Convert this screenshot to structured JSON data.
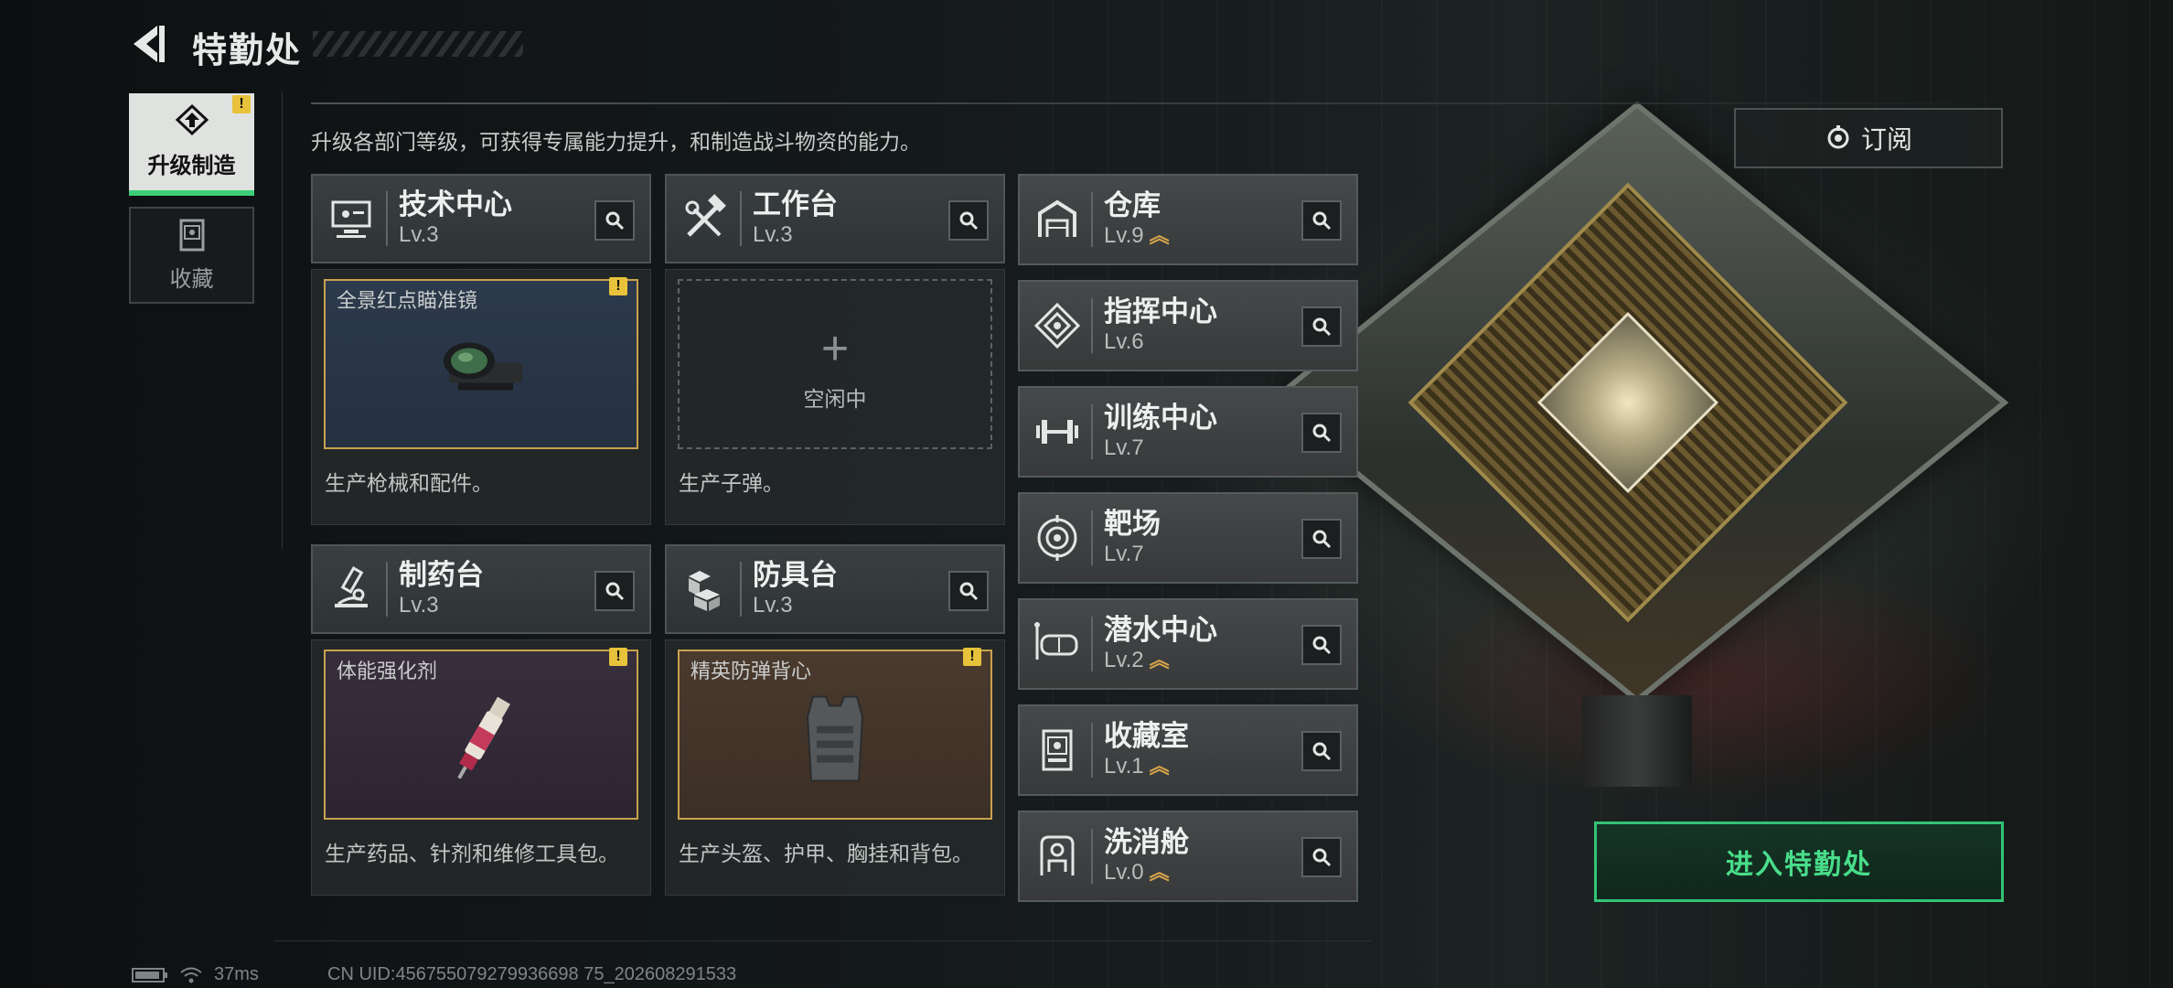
{
  "header": {
    "title": "特勤处"
  },
  "sidebar": {
    "tabs": [
      {
        "label": "升级制造",
        "active": true,
        "warning": "!"
      },
      {
        "label": "收藏",
        "active": false
      }
    ]
  },
  "description": "升级各部门等级，可获得专属能力提升，和制造战斗物资的能力。",
  "subscribe_label": "订阅",
  "production_departments": [
    {
      "name": "技术中心",
      "level": "Lv.3",
      "icon": "computer-icon",
      "slot_item": "全景红点瞄准镜",
      "slot_state": "producing",
      "warning": "!",
      "desc": "生产枪械和配件。"
    },
    {
      "name": "工作台",
      "level": "Lv.3",
      "icon": "tools-icon",
      "slot_item": "",
      "slot_state": "idle",
      "idle_label": "空闲中",
      "desc": "生产子弹。"
    },
    {
      "name": "制药台",
      "level": "Lv.3",
      "icon": "microscope-icon",
      "slot_item": "体能强化剂",
      "slot_state": "producing",
      "warning": "!",
      "desc": "生产药品、针剂和维修工具包。"
    },
    {
      "name": "防具台",
      "level": "Lv.3",
      "icon": "armor-blocks-icon",
      "slot_item": "精英防弹背心",
      "slot_state": "producing",
      "warning": "!",
      "desc": "生产头盔、护甲、胸挂和背包。"
    }
  ],
  "other_departments": [
    {
      "name": "仓库",
      "level": "Lv.9",
      "icon": "warehouse-icon",
      "upgradable": true
    },
    {
      "name": "指挥中心",
      "level": "Lv.6",
      "icon": "command-icon",
      "upgradable": false
    },
    {
      "name": "训练中心",
      "level": "Lv.7",
      "icon": "dumbbell-icon",
      "upgradable": false
    },
    {
      "name": "靶场",
      "level": "Lv.7",
      "icon": "target-icon",
      "upgradable": false
    },
    {
      "name": "潜水中心",
      "level": "Lv.2",
      "icon": "diving-mask-icon",
      "upgradable": true
    },
    {
      "name": "收藏室",
      "level": "Lv.1",
      "icon": "collection-icon",
      "upgradable": true
    },
    {
      "name": "洗消舱",
      "level": "Lv.0",
      "icon": "decon-icon",
      "upgradable": true
    }
  ],
  "enter_button": "进入特勤处",
  "status": {
    "ping": "37ms",
    "uid": "CN UID:456755079279936698 75_202608291533"
  },
  "colors": {
    "accent_green": "#33c374",
    "warning_yellow": "#e7c23a",
    "upgrade_gold": "#d7a54a"
  }
}
